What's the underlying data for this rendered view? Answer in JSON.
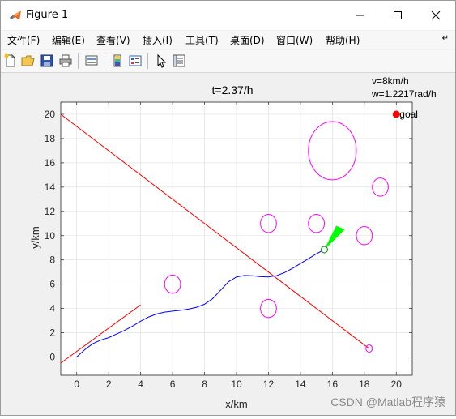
{
  "window": {
    "title": "Figure 1",
    "controls": {
      "minimize": "minimize",
      "maximize": "maximize",
      "close": "close"
    }
  },
  "menu": {
    "items": [
      {
        "label": "文件(F)"
      },
      {
        "label": "编辑(E)"
      },
      {
        "label": "查看(V)"
      },
      {
        "label": "插入(I)"
      },
      {
        "label": "工具(T)"
      },
      {
        "label": "桌面(D)"
      },
      {
        "label": "窗口(W)"
      },
      {
        "label": "帮助(H)"
      }
    ],
    "overflow_icon": "dock-arrow-icon"
  },
  "toolbar": {
    "buttons": [
      "new-figure-icon",
      "open-file-icon",
      "save-icon",
      "print-icon",
      "link-plot-icon",
      "colorbar-icon",
      "legend-icon",
      "select-arrow-icon",
      "property-inspector-icon"
    ]
  },
  "plot": {
    "title": "t=2.37/h",
    "info_velocity": "v=8km/h",
    "info_omega": "w=1.2217rad/h",
    "goal_label": "goal",
    "watermark": "CSDN @Matlab程序猿"
  },
  "chart_data": {
    "type": "line",
    "xlabel": "x/km",
    "ylabel": "y/km",
    "xlim": [
      -1,
      21
    ],
    "ylim": [
      -1.5,
      21
    ],
    "xticks": [
      0,
      2,
      4,
      6,
      8,
      10,
      12,
      14,
      16,
      18,
      20
    ],
    "yticks": [
      0,
      2,
      4,
      6,
      8,
      10,
      12,
      14,
      16,
      18,
      20
    ],
    "grid": true,
    "colors": {
      "path": "#0000ff",
      "lines": "#ff0000",
      "obstacles": "#ff00ff",
      "heading": "#00ff00",
      "goal": "#ff0000",
      "robot": "#008000"
    },
    "path": {
      "x": [
        0,
        0.5,
        1,
        1.5,
        2,
        2.5,
        3,
        3.5,
        4,
        4.5,
        5,
        5.5,
        6,
        6.5,
        7,
        7.5,
        8,
        8.5,
        9,
        9.5,
        10,
        10.5,
        11,
        11.5,
        12,
        12.5,
        13,
        13.5,
        14,
        14.5,
        15,
        15.5
      ],
      "y": [
        0,
        0.6,
        1.1,
        1.4,
        1.6,
        1.9,
        2.2,
        2.55,
        2.95,
        3.3,
        3.55,
        3.7,
        3.78,
        3.85,
        3.95,
        4.1,
        4.35,
        4.8,
        5.5,
        6.2,
        6.6,
        6.72,
        6.7,
        6.62,
        6.6,
        6.7,
        6.95,
        7.3,
        7.7,
        8.1,
        8.5,
        8.85
      ]
    },
    "line_1": {
      "x": [
        -1,
        4
      ],
      "y": [
        -0.5,
        4.3
      ]
    },
    "line_2": {
      "x": [
        -1,
        18.3
      ],
      "y": [
        20,
        0.7
      ]
    },
    "obstacles": [
      {
        "x": 16,
        "y": 17,
        "rx": 1.5,
        "ry": 2.4
      },
      {
        "x": 19,
        "y": 14,
        "rx": 0.5,
        "ry": 0.75
      },
      {
        "x": 12,
        "y": 11,
        "rx": 0.5,
        "ry": 0.75
      },
      {
        "x": 15,
        "y": 11,
        "rx": 0.5,
        "ry": 0.75
      },
      {
        "x": 18,
        "y": 10,
        "rx": 0.5,
        "ry": 0.75
      },
      {
        "x": 6,
        "y": 6,
        "rx": 0.5,
        "ry": 0.75
      },
      {
        "x": 12,
        "y": 4,
        "rx": 0.5,
        "ry": 0.75
      },
      {
        "x": 18.3,
        "y": 0.7,
        "rx": 0.2,
        "ry": 0.3
      }
    ],
    "robot": {
      "x": 15.5,
      "y": 8.85
    },
    "heading_sector": [
      [
        15.5,
        8.85
      ],
      [
        16.25,
        10.8
      ],
      [
        16.75,
        10.5
      ]
    ],
    "goal": {
      "x": 20,
      "y": 20
    }
  }
}
